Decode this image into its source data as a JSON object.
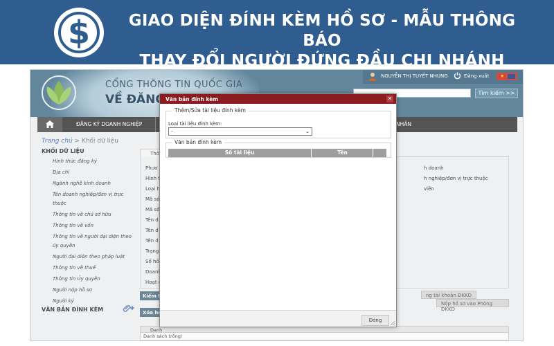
{
  "banner": {
    "title_line1": "GIAO DIỆN ĐÍNH KÈM HỒ SƠ - MẪU THÔNG BÁO",
    "title_line2": "THAY ĐỔI NGƯỜI ĐỨNG ĐẦU CHI NHÁNH",
    "logo_glyph": "$"
  },
  "header": {
    "portal_name": "CỔNG THÔNG TIN QUỐC GIA",
    "portal_sub": "VỀ ĐĂNG",
    "user_name": "NGUYỄN THỊ TUYẾT NHUNG",
    "logout_label": "Đăng xuất",
    "search_button": "Tìm kiếm >>",
    "search_value": ""
  },
  "nav": {
    "item1": "ĐĂNG KÝ DOANH NGHIỆP",
    "item_right": "NHÂN"
  },
  "breadcrumb": {
    "home": "Trang chủ",
    "separator": " > ",
    "current": "Khối dữ liệu"
  },
  "sidebar": {
    "heading": "KHỐI DỮ LIỆU",
    "items": [
      "Hình thức đăng ký",
      "Địa chỉ",
      "Ngành nghề kinh doanh",
      "Tên doanh nghiệp/đơn vị trực thuộc",
      "Thông tin về chủ sở hữu",
      "Thông tin về vốn",
      "Thông tin về người đại diện theo ủy quyền",
      "Người đại diện theo pháp luật",
      "Thông tin về thuế",
      "Thông tin Ủy quyền",
      "Người nộp hồ sơ",
      "Người ký"
    ],
    "attach_heading": "VĂN BẢN ĐÍNH KÈM"
  },
  "content": {
    "tab_stub": "Thô",
    "field_stubs": [
      "Phươ",
      "Hình t",
      "Loại h",
      "Mã số",
      "Mã số",
      "Tên d",
      "Tên d",
      "Tên d",
      "Trạng",
      "Số hồ",
      "Doanh",
      "Hoạt đ"
    ],
    "right_labels": [
      "h doanh",
      "h nghiệp/đơn vị trực thuộc",
      "viên"
    ],
    "check_button": "Kiểm t",
    "delete_button": "Xóa hồ",
    "account_button": "ng tài khoản ĐKKD",
    "submit_button": "Nộp hồ sơ vào Phòng ĐKKD",
    "list_header": "Danh",
    "list_empty": "Danh sách trống!"
  },
  "modal": {
    "title": "Văn bản đính kèm",
    "close_glyph": "✕",
    "fieldset1_legend": "Thêm/Sửa tài liệu đính kèm",
    "doc_type_label": "Loại tài liệu đính kèm:",
    "doc_type_value": "-",
    "fieldset2_legend": "Văn bản đính kèm",
    "col_doc_number": "Số tài liệu",
    "col_name": "Tên",
    "close_button": "Đóng"
  },
  "colors": {
    "banner_bg": "#2f5d8f",
    "modal_title_bg": "#8c1b1f",
    "header_bg": "#4d7790",
    "nav_bg": "#3d3d3d"
  }
}
